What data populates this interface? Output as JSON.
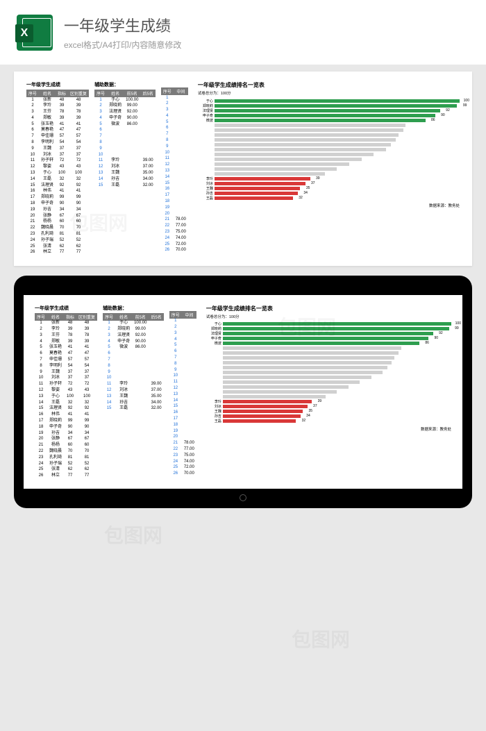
{
  "header": {
    "title": "一年级学生成绩",
    "subtitle": "excel格式/A4打印/内容随意修改",
    "icon_letter": "X"
  },
  "sheet": {
    "main_title": "一年级学生成绩",
    "aux_title": "辅助数据：",
    "main_headers": [
      "序号",
      "姓名",
      "指标",
      "区别重复"
    ],
    "main_rows": [
      [
        "1",
        "张新",
        "48",
        "48"
      ],
      [
        "2",
        "李玲",
        "39",
        "39"
      ],
      [
        "3",
        "王芬",
        "78",
        "78"
      ],
      [
        "4",
        "郑敏",
        "39",
        "39"
      ],
      [
        "5",
        "张玉艳",
        "41",
        "41"
      ],
      [
        "6",
        "莫春艳",
        "47",
        "47"
      ],
      [
        "7",
        "申佳珊",
        "57",
        "57"
      ],
      [
        "8",
        "李明利",
        "54",
        "54"
      ],
      [
        "9",
        "王魏",
        "37",
        "37"
      ],
      [
        "10",
        "刘冰",
        "37",
        "37"
      ],
      [
        "11",
        "孙子轩",
        "72",
        "72"
      ],
      [
        "12",
        "黎姿",
        "43",
        "43"
      ],
      [
        "13",
        "于心",
        "100",
        "100"
      ],
      [
        "14",
        "王磊",
        "32",
        "32"
      ],
      [
        "15",
        "法理贤",
        "92",
        "92"
      ],
      [
        "16",
        "林伟",
        "41",
        "41"
      ],
      [
        "17",
        "郑晓莉",
        "99",
        "99"
      ],
      [
        "18",
        "申子奇",
        "90",
        "90"
      ],
      [
        "19",
        "孙吉",
        "34",
        "34"
      ],
      [
        "20",
        "张静",
        "67",
        "67"
      ],
      [
        "21",
        "杨杨",
        "60",
        "60"
      ],
      [
        "22",
        "魏晓晨",
        "70",
        "70"
      ],
      [
        "23",
        "孔利琦",
        "81",
        "81"
      ],
      [
        "24",
        "孙子瑞",
        "52",
        "52"
      ],
      [
        "25",
        "张清",
        "62",
        "62"
      ],
      [
        "26",
        "林立",
        "77",
        "77"
      ]
    ],
    "aux1_headers": [
      "序号",
      "姓名",
      "前5名",
      "后5名"
    ],
    "aux1_rows": [
      [
        "1",
        "于心",
        "100.00",
        ""
      ],
      [
        "2",
        "郑晓莉",
        "99.00",
        ""
      ],
      [
        "3",
        "法理贤",
        "92.00",
        ""
      ],
      [
        "4",
        "申子奇",
        "90.00",
        ""
      ],
      [
        "5",
        "微波",
        "86.00",
        ""
      ],
      [
        "6",
        "",
        "",
        ""
      ],
      [
        "7",
        "",
        "",
        ""
      ],
      [
        "8",
        "",
        "",
        ""
      ],
      [
        "9",
        "",
        "",
        ""
      ],
      [
        "10",
        "",
        "",
        ""
      ],
      [
        "11",
        "李玲",
        "",
        "39.00"
      ],
      [
        "12",
        "刘冰",
        "",
        "37.00"
      ],
      [
        "13",
        "王魏",
        "",
        "35.00"
      ],
      [
        "14",
        "孙吉",
        "",
        "34.00"
      ],
      [
        "15",
        "王磊",
        "",
        "32.00"
      ]
    ],
    "aux2_headers": [
      "序号",
      "中间"
    ],
    "aux2_rows": [
      [
        "1",
        ""
      ],
      [
        "2",
        ""
      ],
      [
        "3",
        ""
      ],
      [
        "4",
        ""
      ],
      [
        "5",
        ""
      ],
      [
        "6",
        ""
      ],
      [
        "7",
        ""
      ],
      [
        "8",
        ""
      ],
      [
        "9",
        ""
      ],
      [
        "10",
        ""
      ],
      [
        "11",
        ""
      ],
      [
        "12",
        ""
      ],
      [
        "13",
        ""
      ],
      [
        "14",
        ""
      ],
      [
        "15",
        ""
      ],
      [
        "16",
        ""
      ],
      [
        "17",
        ""
      ],
      [
        "18",
        ""
      ],
      [
        "19",
        ""
      ],
      [
        "20",
        ""
      ],
      [
        "21",
        "78.00"
      ],
      [
        "22",
        "77.00"
      ],
      [
        "23",
        "75.00"
      ],
      [
        "24",
        "74.00"
      ],
      [
        "25",
        "72.00"
      ],
      [
        "26",
        "70.00"
      ]
    ]
  },
  "chart_data": {
    "type": "bar",
    "title": "一年级学生成绩排名一览表",
    "subtitle": "试卷总分为：100分",
    "footer": "数据来源：教务处",
    "xlim": [
      0,
      100
    ],
    "series": [
      {
        "name": "于心",
        "value": 100,
        "color": "green"
      },
      {
        "name": "郑晓莉",
        "value": 99,
        "color": "green"
      },
      {
        "name": "法理贤",
        "value": 92,
        "color": "green"
      },
      {
        "name": "申子奇",
        "value": 90,
        "color": "green"
      },
      {
        "name": "微波",
        "value": 86,
        "color": "green"
      },
      {
        "name": "",
        "value": 78,
        "color": "grey"
      },
      {
        "name": "",
        "value": 77,
        "color": "grey"
      },
      {
        "name": "",
        "value": 75,
        "color": "grey"
      },
      {
        "name": "",
        "value": 74,
        "color": "grey"
      },
      {
        "name": "",
        "value": 72,
        "color": "grey"
      },
      {
        "name": "",
        "value": 70,
        "color": "grey"
      },
      {
        "name": "",
        "value": 65,
        "color": "grey"
      },
      {
        "name": "",
        "value": 60,
        "color": "grey"
      },
      {
        "name": "",
        "value": 55,
        "color": "grey"
      },
      {
        "name": "",
        "value": 50,
        "color": "grey"
      },
      {
        "name": "",
        "value": 45,
        "color": "grey"
      },
      {
        "name": "李玲",
        "value": 39,
        "color": "red"
      },
      {
        "name": "刘冰",
        "value": 37,
        "color": "red"
      },
      {
        "name": "王魏",
        "value": 35,
        "color": "red"
      },
      {
        "name": "孙吉",
        "value": 34,
        "color": "red"
      },
      {
        "name": "王磊",
        "value": 32,
        "color": "red"
      }
    ]
  }
}
